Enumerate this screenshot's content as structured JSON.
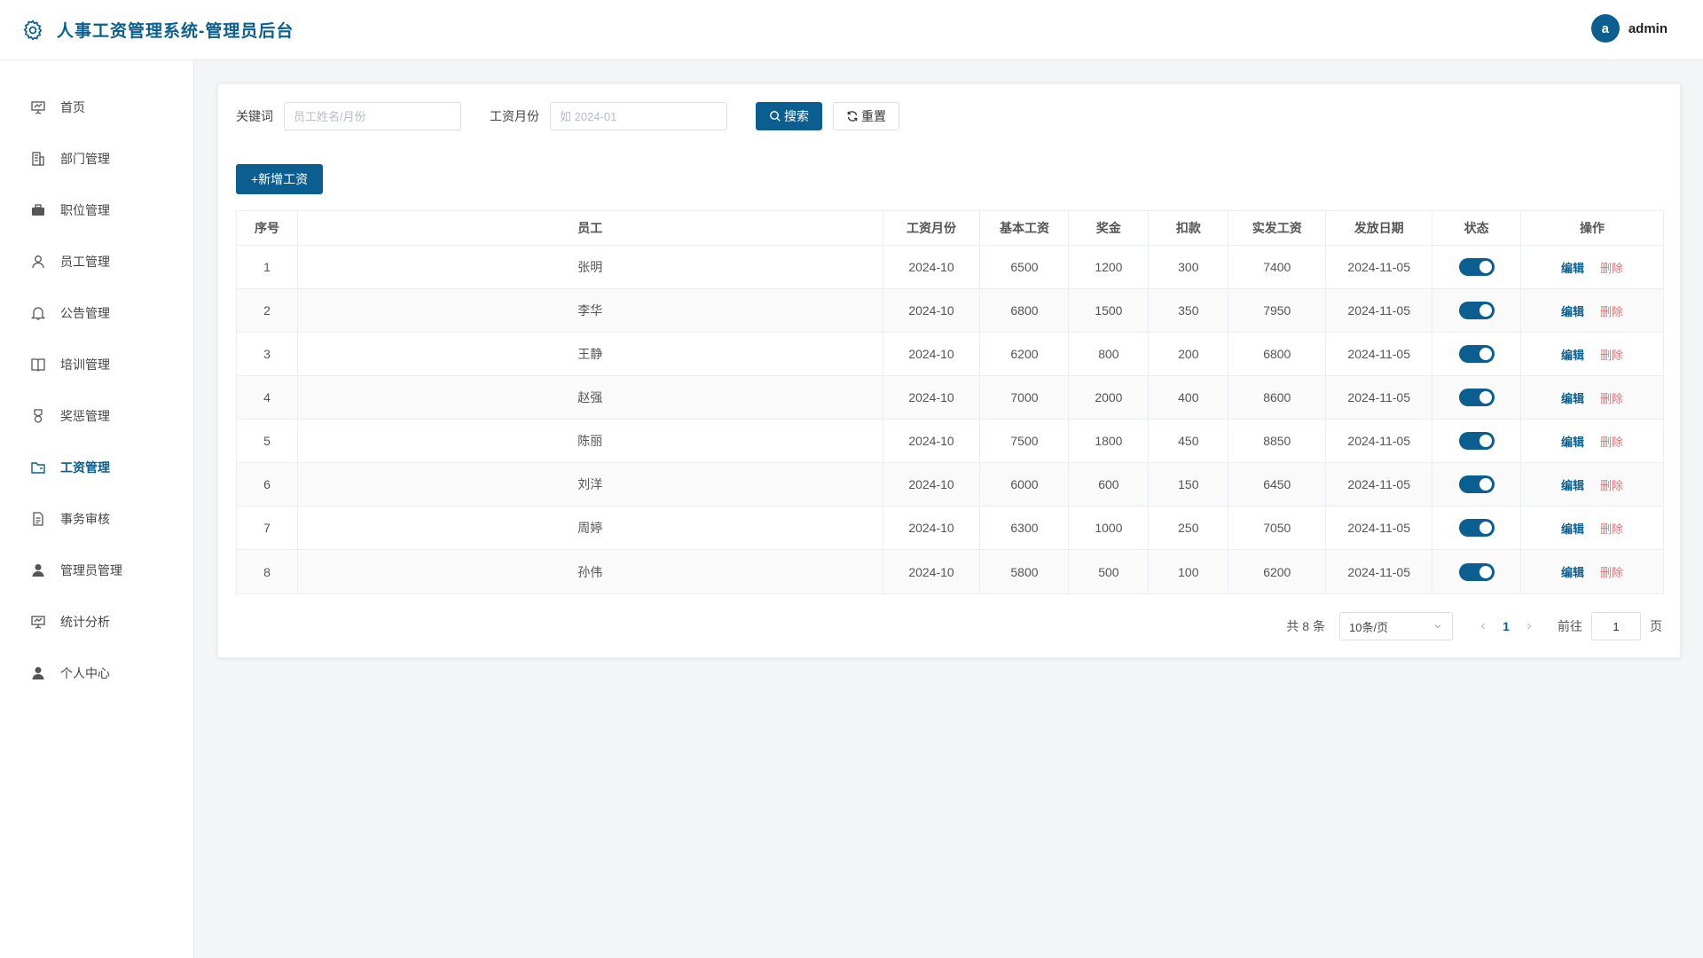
{
  "header": {
    "title": "人事工资管理系统-管理员后台",
    "avatar_letter": "a",
    "username": "admin",
    "icon": "gear-icon"
  },
  "sidebar": {
    "items": [
      {
        "label": "首页",
        "icon": "presentation-icon",
        "active": false
      },
      {
        "label": "部门管理",
        "icon": "building-icon",
        "active": false
      },
      {
        "label": "职位管理",
        "icon": "briefcase-icon",
        "active": false
      },
      {
        "label": "员工管理",
        "icon": "user-outline-icon",
        "active": false
      },
      {
        "label": "公告管理",
        "icon": "bell-icon",
        "active": false
      },
      {
        "label": "培训管理",
        "icon": "book-icon",
        "active": false
      },
      {
        "label": "奖惩管理",
        "icon": "medal-icon",
        "active": false
      },
      {
        "label": "工资管理",
        "icon": "wallet-icon",
        "active": true
      },
      {
        "label": "事务审核",
        "icon": "document-icon",
        "active": false
      },
      {
        "label": "管理员管理",
        "icon": "user-solid-icon",
        "active": false
      },
      {
        "label": "统计分析",
        "icon": "presentation-icon",
        "active": false
      },
      {
        "label": "个人中心",
        "icon": "user-solid-icon",
        "active": false
      }
    ]
  },
  "search": {
    "keyword_label": "关键词",
    "keyword_placeholder": "员工姓名/月份",
    "month_label": "工资月份",
    "month_placeholder": "如 2024-01",
    "search_button": "搜索",
    "reset_button": "重置"
  },
  "toolbar": {
    "add_button": "+新增工资"
  },
  "table": {
    "headers": [
      "序号",
      "员工",
      "工资月份",
      "基本工资",
      "奖金",
      "扣款",
      "实发工资",
      "发放日期",
      "状态",
      "操作"
    ],
    "edit_label": "编辑",
    "delete_label": "删除",
    "rows": [
      {
        "idx": "1",
        "name": "张明",
        "month": "2024-10",
        "base": "6500",
        "bonus": "1200",
        "deduct": "300",
        "net": "7400",
        "date": "2024-11-05",
        "status": true
      },
      {
        "idx": "2",
        "name": "李华",
        "month": "2024-10",
        "base": "6800",
        "bonus": "1500",
        "deduct": "350",
        "net": "7950",
        "date": "2024-11-05",
        "status": true
      },
      {
        "idx": "3",
        "name": "王静",
        "month": "2024-10",
        "base": "6200",
        "bonus": "800",
        "deduct": "200",
        "net": "6800",
        "date": "2024-11-05",
        "status": true
      },
      {
        "idx": "4",
        "name": "赵强",
        "month": "2024-10",
        "base": "7000",
        "bonus": "2000",
        "deduct": "400",
        "net": "8600",
        "date": "2024-11-05",
        "status": true
      },
      {
        "idx": "5",
        "name": "陈丽",
        "month": "2024-10",
        "base": "7500",
        "bonus": "1800",
        "deduct": "450",
        "net": "8850",
        "date": "2024-11-05",
        "status": true
      },
      {
        "idx": "6",
        "name": "刘洋",
        "month": "2024-10",
        "base": "6000",
        "bonus": "600",
        "deduct": "150",
        "net": "6450",
        "date": "2024-11-05",
        "status": true
      },
      {
        "idx": "7",
        "name": "周婷",
        "month": "2024-10",
        "base": "6300",
        "bonus": "1000",
        "deduct": "250",
        "net": "7050",
        "date": "2024-11-05",
        "status": true
      },
      {
        "idx": "8",
        "name": "孙伟",
        "month": "2024-10",
        "base": "5800",
        "bonus": "500",
        "deduct": "100",
        "net": "6200",
        "date": "2024-11-05",
        "status": true
      }
    ]
  },
  "pagination": {
    "total_text": "共 8 条",
    "page_size": "10条/页",
    "current_page": "1",
    "goto_label": "前往",
    "goto_value": "1",
    "page_unit": "页"
  },
  "colors": {
    "primary": "#0b5f90",
    "danger": "#f56c6c",
    "background": "#f4f5f7"
  }
}
